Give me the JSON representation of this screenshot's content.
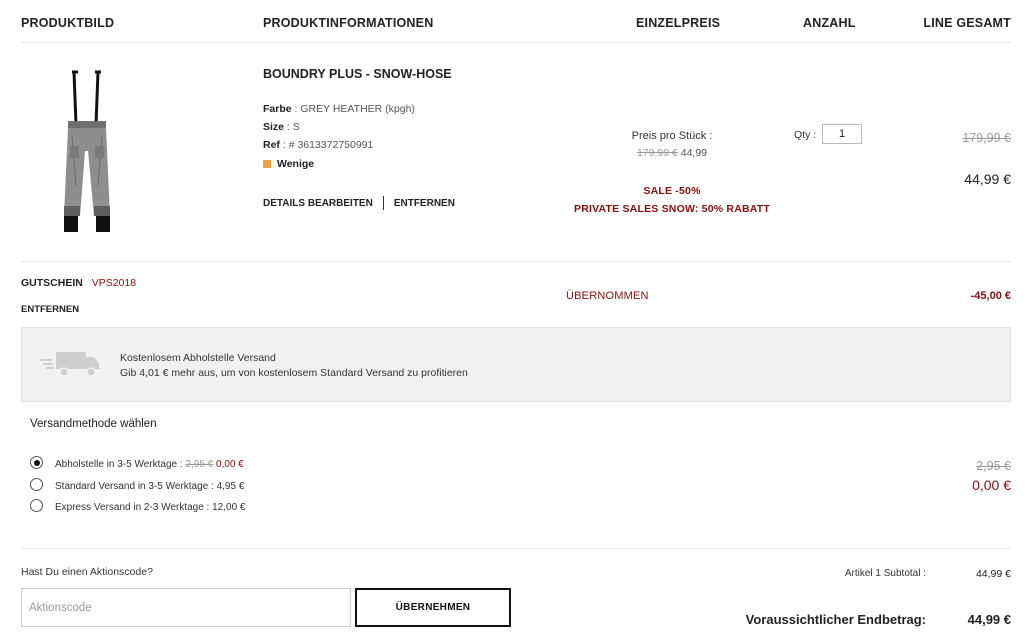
{
  "header": {
    "col_image": "PRODUKTBILD",
    "col_info": "PRODUKTINFORMATIONEN",
    "col_unit_price": "EINZELPREIS",
    "col_qty": "ANZAHL",
    "col_total": "LINE GESAMT"
  },
  "item": {
    "title": "BOUNDRY PLUS - SNOW-HOSE",
    "color_label": "Farbe",
    "color_value": "GREY HEATHER (kpgh)",
    "size_label": "Size",
    "size_value": "S",
    "ref_label": "Ref",
    "ref_value": "# 3613372750991",
    "stock": "Wenige",
    "edit_label": "DETAILS BEARBEITEN",
    "remove_label": "ENTFERNEN",
    "unit_price_label": "Preis pro Stück :",
    "unit_price_old": "179,99 €",
    "unit_price_new": "44,99",
    "sale_line1": "SALE -50%",
    "sale_line2": "PRIVATE SALES SNOW: 50% RABATT",
    "qty_label": "Qty :",
    "qty_value": "1",
    "total_old": "179,99 €",
    "total_new": "44,99 €"
  },
  "voucher": {
    "label": "GUTSCHEIN",
    "code": "VPS2018",
    "remove_label": "ENTFERNEN",
    "status": "ÜBERNOMMEN",
    "amount": "-45,00 €"
  },
  "shipping_notice": {
    "line1": "Kostenlosem Abholstelle Versand",
    "line2": "Gib 4,01 € mehr aus, um von kostenlosem Standard Versand zu profitieren"
  },
  "shipping_method": {
    "heading": "Versandmethode wählen",
    "options": [
      {
        "label": "Abholstelle in 3-5 Werktage :",
        "old_price": "2,95 €",
        "price": "0,00 €",
        "selected": true
      },
      {
        "label": "Standard Versand in 3-5 Werktage : 4,95 €",
        "selected": false
      },
      {
        "label": "Express Versand in 2-3 Werktage : 12,00 €",
        "selected": false
      }
    ],
    "total_old": "2,95 €",
    "total_new": "0,00 €"
  },
  "promo": {
    "question": "Hast Du einen Aktionscode?",
    "placeholder": "Aktionscode",
    "button_label": "ÜBERNEHMEN"
  },
  "summary": {
    "subtotal_label": "Artikel 1 Subtotal :",
    "subtotal_value": "44,99 €",
    "final_label": "Voraussichtlicher Endbetrag:",
    "final_value": "44,99 €"
  },
  "colors": {
    "accent_red": "#8b0c0c",
    "stock_orange": "#f0a045"
  }
}
